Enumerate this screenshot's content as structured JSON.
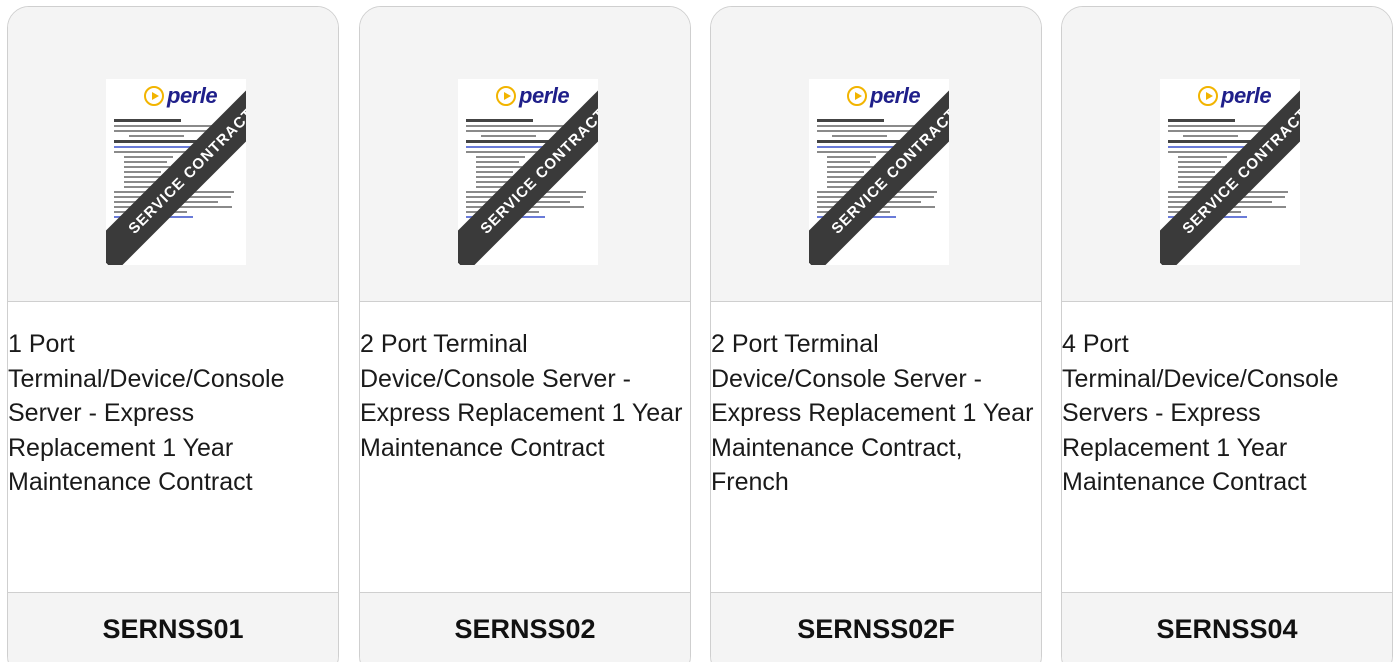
{
  "products": [
    {
      "thumbnail_ribbon": "SERVICE CONTRACT",
      "logo_text": "perle",
      "description": "1 Port Terminal/Device/Console Server - Express Replacement 1 Year Maintenance Contract",
      "sku": "SERNSS01"
    },
    {
      "thumbnail_ribbon": "SERVICE CONTRACT",
      "logo_text": "perle",
      "description": "2 Port Terminal Device/Console Server - Express Replacement 1 Year Maintenance Contract",
      "sku": "SERNSS02"
    },
    {
      "thumbnail_ribbon": "SERVICE CONTRACT",
      "logo_text": "perle",
      "description": "2 Port Terminal Device/Console Server - Express Replacement 1 Year Maintenance Contract, French",
      "sku": "SERNSS02F"
    },
    {
      "thumbnail_ribbon": "SERVICE CONTRACT",
      "logo_text": "perle",
      "description": "4 Port Terminal/Device/Console Servers - Express Replacement 1 Year Maintenance Contract",
      "sku": "SERNSS04"
    }
  ],
  "colors": {
    "logo_yellow": "#f2b400",
    "logo_blue": "#1f1f8a",
    "ribbon": "#3a3a3a",
    "card_border": "#cfcfcf",
    "panel_bg": "#f4f4f4"
  }
}
